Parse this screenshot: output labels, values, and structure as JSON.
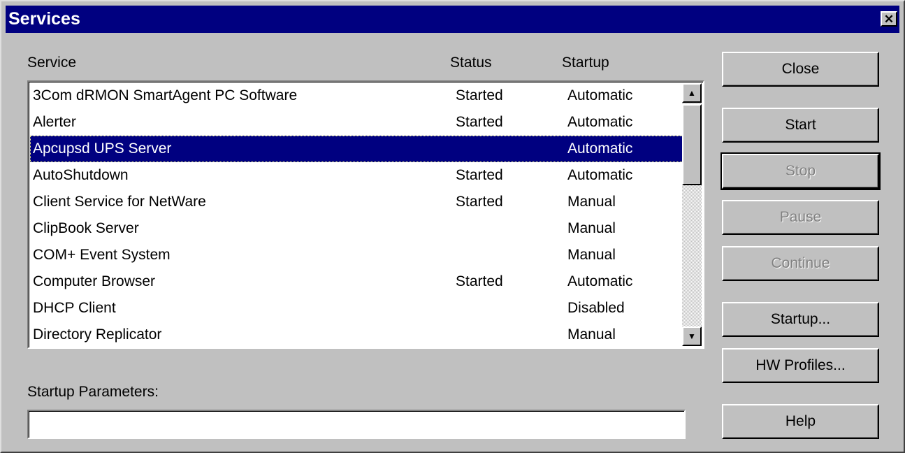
{
  "window": {
    "title": "Services"
  },
  "columns": {
    "service": "Service",
    "status": "Status",
    "startup": "Startup"
  },
  "services": [
    {
      "name": "3Com dRMON SmartAgent PC Software",
      "status": "Started",
      "startup": "Automatic"
    },
    {
      "name": "Alerter",
      "status": "Started",
      "startup": "Automatic"
    },
    {
      "name": "Apcupsd UPS Server",
      "status": "",
      "startup": "Automatic",
      "selected": true
    },
    {
      "name": "AutoShutdown",
      "status": "Started",
      "startup": "Automatic"
    },
    {
      "name": "Client Service for NetWare",
      "status": "Started",
      "startup": "Manual"
    },
    {
      "name": "ClipBook Server",
      "status": "",
      "startup": "Manual"
    },
    {
      "name": "COM+ Event System",
      "status": "",
      "startup": "Manual"
    },
    {
      "name": "Computer Browser",
      "status": "Started",
      "startup": "Automatic"
    },
    {
      "name": "DHCP Client",
      "status": "",
      "startup": "Disabled"
    },
    {
      "name": "Directory Replicator",
      "status": "",
      "startup": "Manual"
    }
  ],
  "startup_parameters": {
    "label": "Startup Parameters:",
    "value": ""
  },
  "buttons": {
    "close": "Close",
    "start": "Start",
    "stop": "Stop",
    "pause": "Pause",
    "continue": "Continue",
    "startup": "Startup...",
    "hw_profiles": "HW Profiles...",
    "help": "Help"
  },
  "icons": {
    "title_close": "close-icon",
    "scroll_up": "scroll-up-arrow-icon",
    "scroll_down": "scroll-down-arrow-icon"
  },
  "colors": {
    "titlebar": "#000080",
    "selection": "#000080",
    "face": "#c0c0c0",
    "disabled_text": "#808080"
  }
}
